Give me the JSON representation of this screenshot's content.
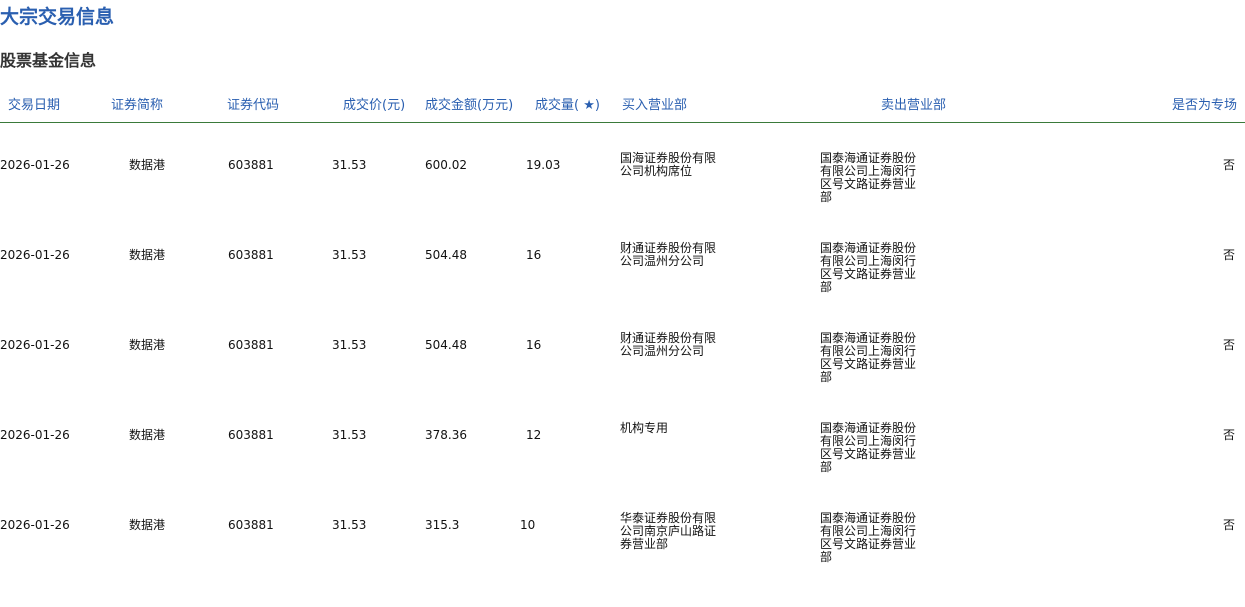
{
  "page": {
    "title": "大宗交易信息",
    "section_title": "股票基金信息"
  },
  "table": {
    "headers": {
      "date": "交易日期",
      "name": "证券简称",
      "code": "证券代码",
      "price": "成交价(元)",
      "amount": "成交金额(万元)",
      "volume": "成交量( ★)",
      "buyer": "买入营业部",
      "seller": "卖出营业部",
      "special": "是否为专场"
    },
    "rows": [
      {
        "date": "2026-01-26",
        "name": "数据港",
        "code": "603881",
        "price": "31.53",
        "amount": "600.02",
        "volume": "19.03",
        "buyer": "国海证券股份有限公司机构席位",
        "seller": "国泰海通证券股份有限公司上海闵行区号文路证券营业部",
        "special": "否"
      },
      {
        "date": "2026-01-26",
        "name": "数据港",
        "code": "603881",
        "price": "31.53",
        "amount": "504.48",
        "volume": "16",
        "buyer": "财通证券股份有限公司温州分公司",
        "seller": "国泰海通证券股份有限公司上海闵行区号文路证券营业部",
        "special": "否"
      },
      {
        "date": "2026-01-26",
        "name": "数据港",
        "code": "603881",
        "price": "31.53",
        "amount": "504.48",
        "volume": "16",
        "buyer": "财通证券股份有限公司温州分公司",
        "seller": "国泰海通证券股份有限公司上海闵行区号文路证券营业部",
        "special": "否"
      },
      {
        "date": "2026-01-26",
        "name": "数据港",
        "code": "603881",
        "price": "31.53",
        "amount": "378.36",
        "volume": "12",
        "buyer": "机构专用",
        "seller": "国泰海通证券股份有限公司上海闵行区号文路证券营业部",
        "special": "否"
      },
      {
        "date": "2026-01-26",
        "name": "数据港",
        "code": "603881",
        "price": "31.53",
        "amount": "315.3",
        "volume": "10",
        "buyer": "华泰证券股份有限公司南京庐山路证券营业部",
        "seller": "国泰海通证券股份有限公司上海闵行区号文路证券营业部",
        "special": "否"
      }
    ]
  }
}
